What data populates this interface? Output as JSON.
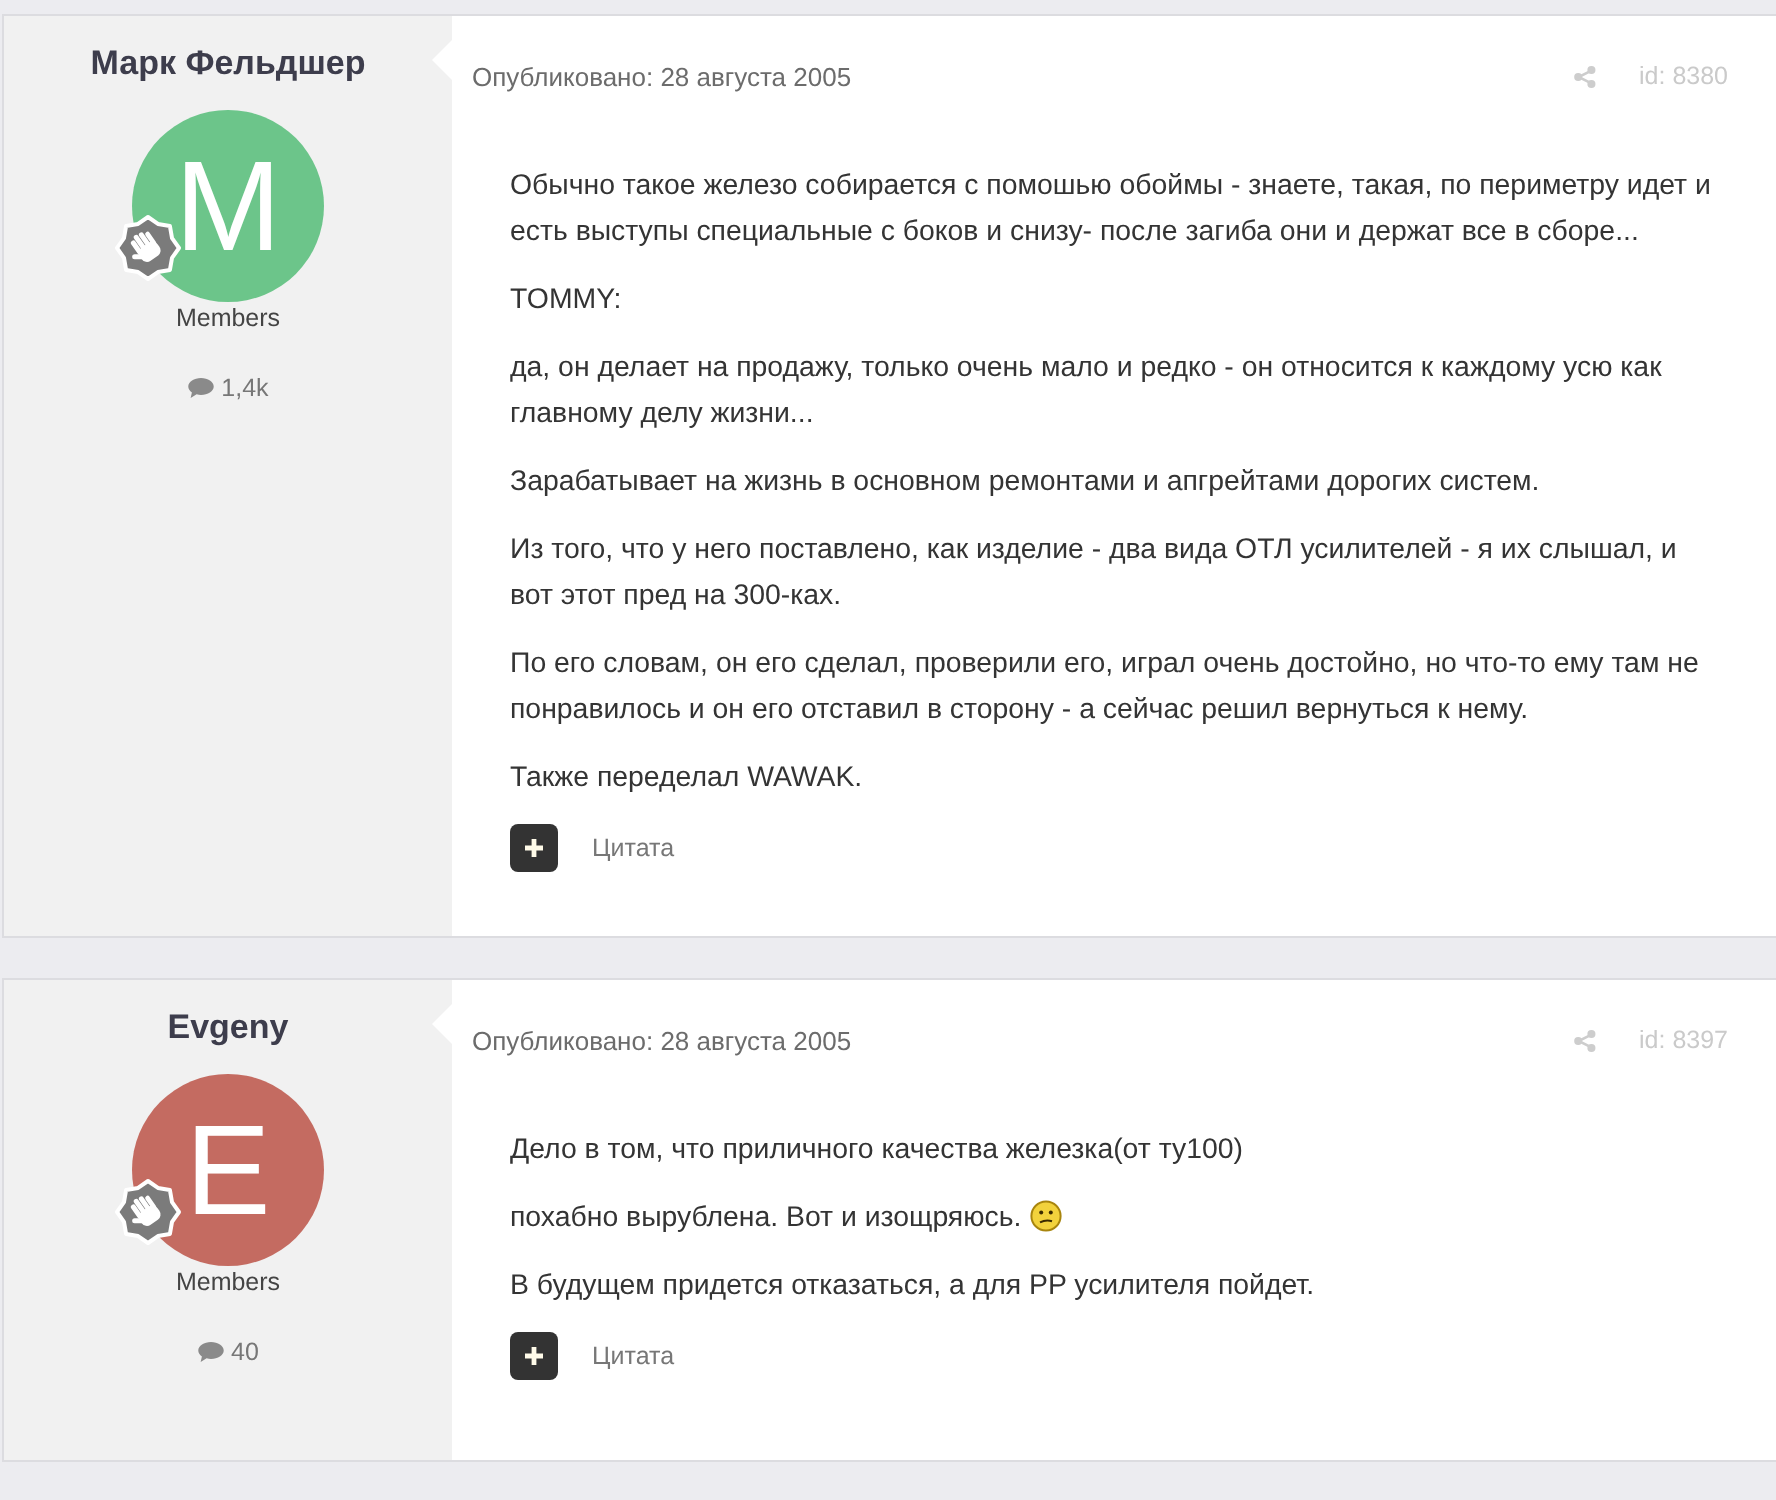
{
  "posts": [
    {
      "author": {
        "name": "Марк Фельдшер",
        "initial": "M",
        "color": "#6cc58a",
        "group": "Members",
        "post_count": "1,4k"
      },
      "date": "Опубликовано: 28 августа 2005",
      "post_id": "id: 8380",
      "paragraphs": [
        {
          "text": "Обычно такое железо собирается с помошью обоймы - знаете, такая, по периметру идет и есть выступы специальные с боков и снизу- после загиба они и держат все в сборе...",
          "emoji": false
        },
        {
          "text": "TOMMY:",
          "emoji": false
        },
        {
          "text": "да, он делает на продажу, только очень мало и редко - он относится к каждому усю как главному делу жизни...",
          "emoji": false
        },
        {
          "text": "Зарабатывает на жизнь в основном ремонтами и апгрейтами дорогих систем.",
          "emoji": false
        },
        {
          "text": "Из того, что у него поставлено, как изделие - два вида ОТЛ усилителей - я их слышал, и вот этот пред на 300-ках.",
          "emoji": false
        },
        {
          "text": "По его словам, он его сделал, проверили его, играл очень достойно, но что-то ему там не понравилось и он его отставил в сторону - а сейчас решил вернуться к нему.",
          "emoji": false
        },
        {
          "text": "Также переделал WAWAK.",
          "emoji": false
        }
      ],
      "quote_label": "Цитата"
    },
    {
      "author": {
        "name": "Evgeny",
        "initial": "E",
        "color": "#c46b61",
        "group": "Members",
        "post_count": "40"
      },
      "date": "Опубликовано: 28 августа 2005",
      "post_id": "id: 8397",
      "paragraphs": [
        {
          "text": "Дело в том, что приличного качества железка(от ту100)",
          "emoji": false
        },
        {
          "text": "похабно вырублена. Вот и изощряюсь.",
          "emoji": true
        },
        {
          "text": "В будущем придется отказаться, а для PP усилителя пойдет.",
          "emoji": false
        }
      ],
      "quote_label": "Цитата"
    }
  ]
}
